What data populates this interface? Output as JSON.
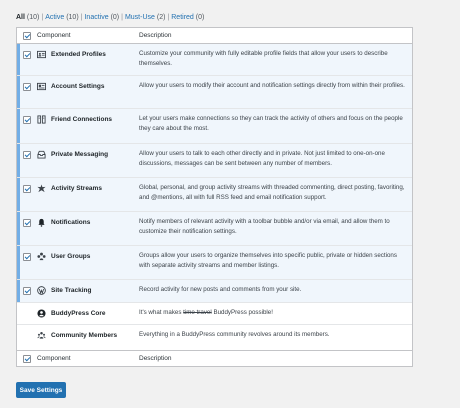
{
  "filters": {
    "all": {
      "label": "All",
      "count": "(10)"
    },
    "active": {
      "label": "Active",
      "count": "(10)"
    },
    "inactive": {
      "label": "Inactive",
      "count": "(0)"
    },
    "must_use": {
      "label": "Must-Use",
      "count": "(2)"
    },
    "retired": {
      "label": "Retired",
      "count": "(0)"
    },
    "separator": "|"
  },
  "table": {
    "header": {
      "component": "Component",
      "description": "Description"
    },
    "footer": {
      "component": "Component",
      "description": "Description"
    },
    "rows": [
      {
        "name": "Extended Profiles",
        "icon": "profile-card-icon",
        "checked": true,
        "description": "Customize your community with fully editable profile fields that allow your users to describe themselves."
      },
      {
        "name": "Account Settings",
        "icon": "settings-card-icon",
        "checked": true,
        "description": "Allow your users to modify their account and notification settings directly from within their profiles."
      },
      {
        "name": "Friend Connections",
        "icon": "friends-icon",
        "checked": true,
        "description": "Let your users make connections so they can track the activity of others and focus on the people they care about the most."
      },
      {
        "name": "Private Messaging",
        "icon": "inbox-icon",
        "checked": true,
        "description": "Allow your users to talk to each other directly and in private. Not just limited to one-on-one discussions, messages can be sent between any number of members."
      },
      {
        "name": "Activity Streams",
        "icon": "activity-icon",
        "checked": true,
        "description": "Global, personal, and group activity streams with threaded commenting, direct posting, favoriting, and @mentions, all with full RSS feed and email notification support."
      },
      {
        "name": "Notifications",
        "icon": "bell-icon",
        "checked": true,
        "description": "Notify members of relevant activity with a toolbar bubble and/or via email, and allow them to customize their notification settings."
      },
      {
        "name": "User Groups",
        "icon": "groups-icon",
        "checked": true,
        "description": "Groups allow your users to organize themselves into specific public, private or hidden sections with separate activity streams and member listings."
      },
      {
        "name": "Site Tracking",
        "icon": "wordpress-icon",
        "checked": true,
        "description": "Record activity for new posts and comments from your site."
      },
      {
        "name": "BuddyPress Core",
        "icon": "buddypress-icon",
        "checked": null,
        "description_before": "It's what makes ",
        "description_strike": "time travel",
        "description_after": " BuddyPress possible!"
      },
      {
        "name": "Community Members",
        "icon": "members-icon",
        "checked": null,
        "description": "Everything in a BuddyPress community revolves around its members."
      }
    ]
  },
  "save_button": "Save Settings"
}
